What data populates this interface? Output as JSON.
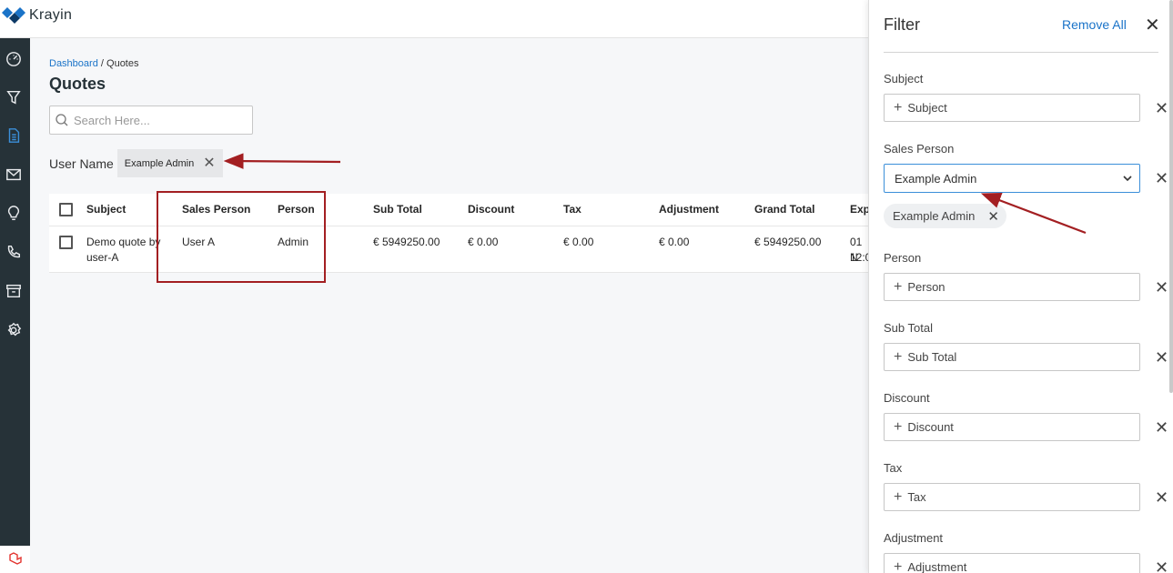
{
  "app": {
    "name": "Krayin"
  },
  "breadcrumb": {
    "home": "Dashboard",
    "separator": "/",
    "current": "Quotes"
  },
  "page": {
    "title": "Quotes"
  },
  "search": {
    "placeholder": "Search Here..."
  },
  "active_filter": {
    "label": "User Name",
    "chip": "Example Admin",
    "remove": "✕"
  },
  "table": {
    "headers": [
      "Subject",
      "Sales Person",
      "Person",
      "Sub Total",
      "Discount",
      "Tax",
      "Adjustment",
      "Grand Total",
      "Exp"
    ],
    "rows": [
      {
        "subject": "Demo quote by user-A",
        "sales_person": "User A",
        "person": "Admin",
        "sub_total": "€ 5949250.00",
        "discount": "€ 0.00",
        "tax": "€ 0.00",
        "adjustment": "€ 0.00",
        "grand_total": "€ 5949250.00",
        "expired_line1": "01 N",
        "expired_line2": "12:0"
      }
    ]
  },
  "filter_panel": {
    "title": "Filter",
    "remove_all": "Remove All",
    "close": "✕",
    "fields": {
      "subject": {
        "label": "Subject",
        "placeholder": "Subject"
      },
      "sales_person": {
        "label": "Sales Person",
        "selected": "Example Admin",
        "chip": "Example Admin"
      },
      "person": {
        "label": "Person",
        "placeholder": "Person"
      },
      "sub_total": {
        "label": "Sub Total",
        "placeholder": "Sub Total"
      },
      "discount": {
        "label": "Discount",
        "placeholder": "Discount"
      },
      "tax": {
        "label": "Tax",
        "placeholder": "Tax"
      },
      "adjustment": {
        "label": "Adjustment",
        "placeholder": "Adjustment"
      }
    },
    "plus": "+",
    "clear": "✕"
  },
  "colors": {
    "accent": "#1a73c8",
    "sidebar": "#263238",
    "annotation": "#a31f22"
  },
  "icons": [
    "dashboard-icon",
    "filter-icon",
    "quotes-icon",
    "mail-icon",
    "bulb-icon",
    "phone-icon",
    "archive-icon",
    "settings-icon"
  ]
}
